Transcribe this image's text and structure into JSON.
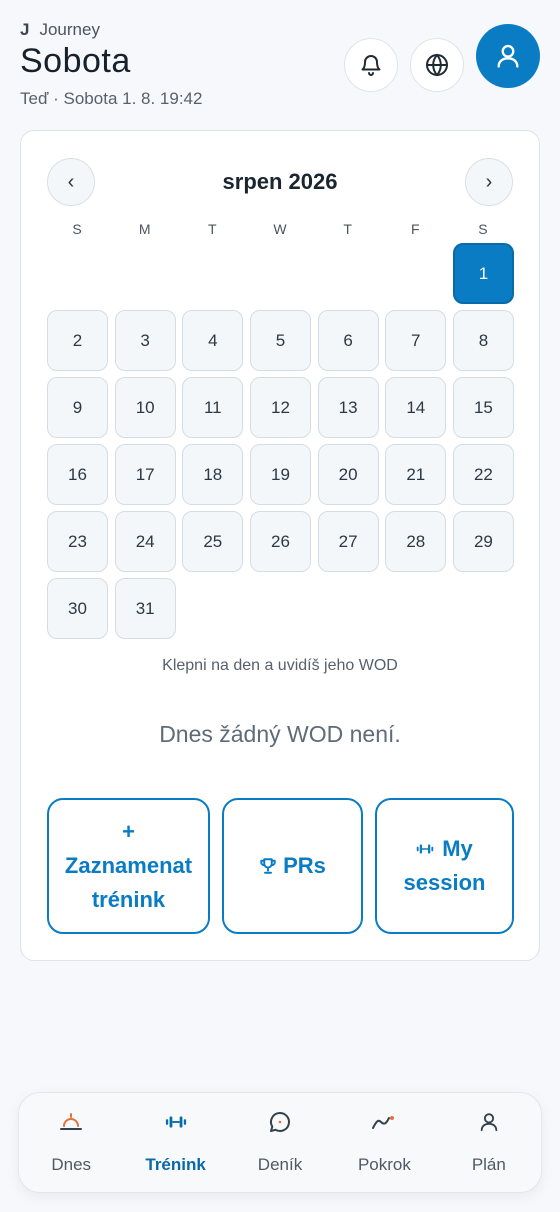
{
  "header": {
    "brand_mark": "J",
    "brand": "Journey",
    "title": "Sobota",
    "subtitle": "Teď · Sobota 1. 8. 19:42"
  },
  "calendar": {
    "month_label": "srpen 2026",
    "prev": "‹",
    "next": "›",
    "weekdays": [
      "S",
      "M",
      "T",
      "W",
      "T",
      "F",
      "S"
    ],
    "weeks": [
      [
        "",
        "",
        "",
        "",
        "",
        "",
        "1"
      ],
      [
        "2",
        "3",
        "4",
        "5",
        "6",
        "7",
        "8"
      ],
      [
        "9",
        "10",
        "11",
        "12",
        "13",
        "14",
        "15"
      ],
      [
        "16",
        "17",
        "18",
        "19",
        "20",
        "21",
        "22"
      ],
      [
        "23",
        "24",
        "25",
        "26",
        "27",
        "28",
        "29"
      ],
      [
        "30",
        "31",
        "",
        "",
        "",
        "",
        ""
      ]
    ],
    "selected_day": "1",
    "hint": "Klepni na den a uvidíš jeho WOD",
    "no_wod": "Dnes žádný WOD není."
  },
  "actions": {
    "log_prefix": "+",
    "log_line1": "Zaznamenat",
    "log_line2": "trénink",
    "prs": "PRs",
    "session_line1": "My",
    "session_line2": "session"
  },
  "tabs": [
    {
      "label": "Dnes",
      "icon": "sunrise-icon"
    },
    {
      "label": "Trénink",
      "icon": "dumbbell-icon",
      "active": true
    },
    {
      "label": "Deník",
      "icon": "chat-icon"
    },
    {
      "label": "Pokrok",
      "icon": "trend-icon"
    },
    {
      "label": "Plán",
      "icon": "user-icon"
    }
  ],
  "colors": {
    "accent": "#0a7cc4",
    "background": "#f6f8fb",
    "card": "#ffffff",
    "day_cell": "#f4f7fa"
  }
}
